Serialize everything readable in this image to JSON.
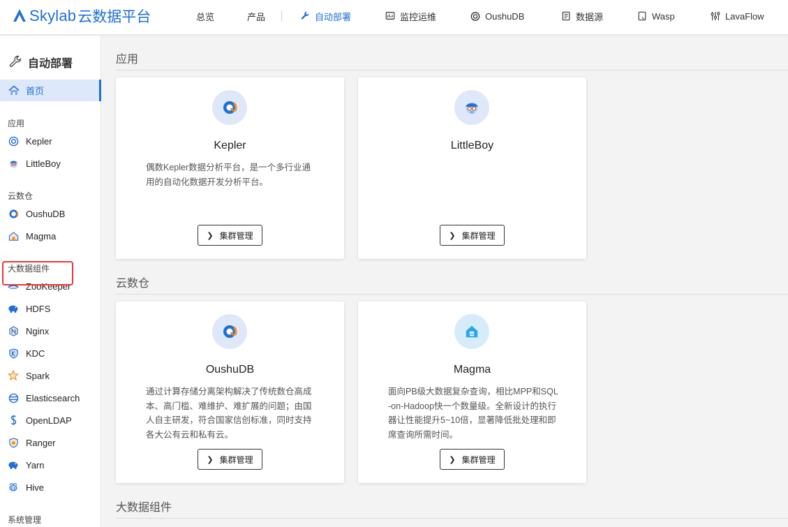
{
  "brand": {
    "name": "Skylab",
    "suffix": "云数据平台"
  },
  "nav": {
    "items": [
      {
        "label": "总览",
        "icon": ""
      },
      {
        "label": "产品",
        "icon": ""
      },
      {
        "label": "自动部署",
        "icon": "wrench-icon"
      },
      {
        "label": "监控运维",
        "icon": "monitor-icon"
      },
      {
        "label": "OushuDB",
        "icon": "oushudb-icon"
      },
      {
        "label": "数据源",
        "icon": "document-icon"
      },
      {
        "label": "Wasp",
        "icon": "wasp-icon"
      },
      {
        "label": "LavaFlow",
        "icon": "flow-icon"
      }
    ],
    "active": "自动部署"
  },
  "sidebar": {
    "title": "自动部署",
    "home": "首页",
    "groups": [
      {
        "label": "应用",
        "items": [
          "Kepler",
          "LittleBoy"
        ]
      },
      {
        "label": "云数仓",
        "items": [
          "OushuDB",
          "Magma"
        ]
      },
      {
        "label": "大数据组件",
        "items": [
          "ZooKeeper",
          "HDFS",
          "Nginx",
          "KDC",
          "Spark",
          "Elasticsearch",
          "OpenLDAP",
          "Ranger",
          "Yarn",
          "Hive"
        ]
      },
      {
        "label": "系统管理",
        "items": []
      }
    ],
    "highlighted": "HDFS"
  },
  "main": {
    "sections": [
      {
        "title": "应用",
        "cards": [
          {
            "name": "Kepler",
            "desc": "偶数Kepler数据分析平台，是一个多行业通用的自动化数据开发分析平台。",
            "button": "集群管理"
          },
          {
            "name": "LittleBoy",
            "desc": "",
            "button": "集群管理"
          }
        ]
      },
      {
        "title": "云数仓",
        "cards": [
          {
            "name": "OushuDB",
            "desc": "通过计算存储分离架构解决了传统数仓高成本、高门槛、难维护、难扩展的问题；由国人自主研发，符合国家信创标准，同时支持各大公有云和私有云。",
            "button": "集群管理"
          },
          {
            "name": "Magma",
            "desc": "面向PB级大数据复杂查询，相比MPP和SQL-on-Hadoop快一个数量级。全新设计的执行器让性能提升5~10倍，显著降低批处理和即席查询所需时间。",
            "button": "集群管理"
          }
        ]
      },
      {
        "title": "大数据组件",
        "cards": []
      }
    ]
  },
  "colors": {
    "accent": "#1e6fd9",
    "highlight": "#e53935"
  }
}
